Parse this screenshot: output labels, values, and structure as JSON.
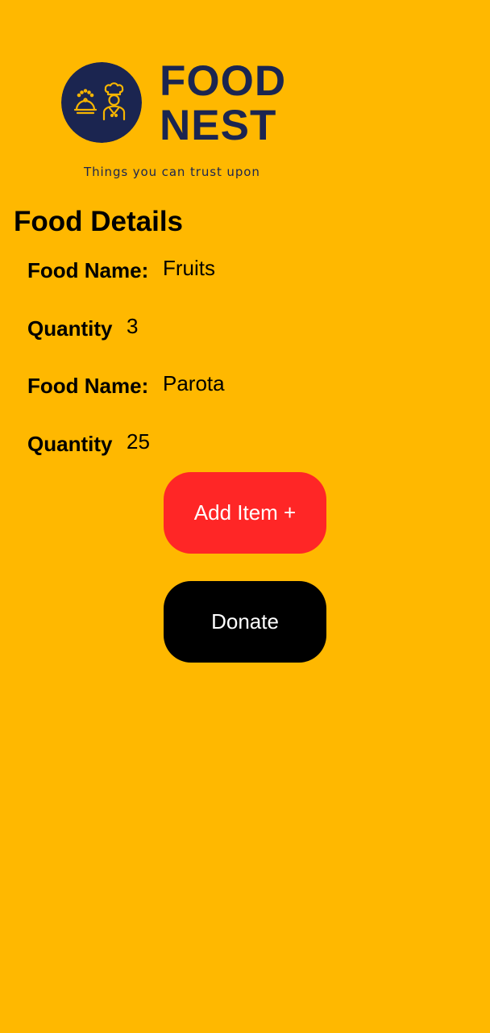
{
  "colors": {
    "background": "#FFB800",
    "brand_navy": "#1B2550",
    "logo_gold": "#F7B500",
    "text": "#000000",
    "add_button": "#FF2626",
    "donate_button": "#000000",
    "button_text": "#FFFFFF"
  },
  "logo": {
    "icon": "chef-serving-cloche-icon",
    "line1": "FOOD",
    "line2": "NEST",
    "tagline": "Things you can trust upon"
  },
  "page_title": "Food Details",
  "items": [
    {
      "name_label": "Food Name:",
      "name_value": "Fruits",
      "quantity_label": "Quantity",
      "quantity_value": "3"
    },
    {
      "name_label": "Food Name:",
      "name_value": "Parota",
      "quantity_label": "Quantity",
      "quantity_value": "25"
    }
  ],
  "buttons": {
    "add_item": "Add Item +",
    "donate": "Donate"
  }
}
